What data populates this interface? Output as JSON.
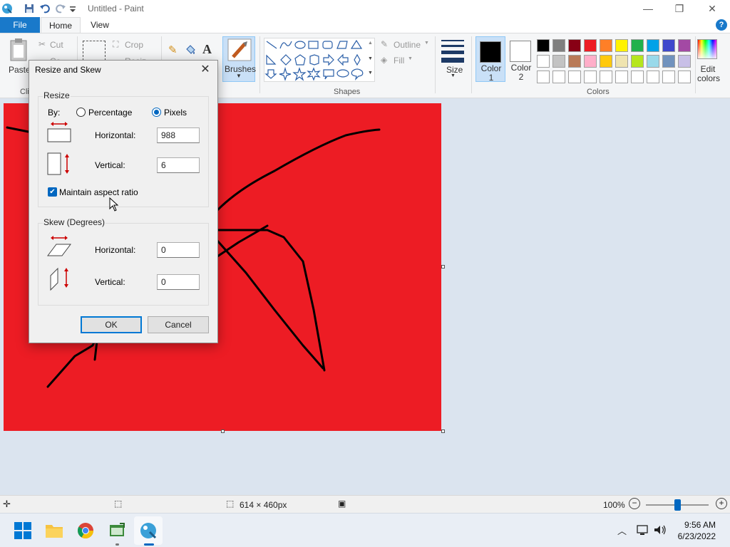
{
  "window": {
    "title": "Untitled - Paint",
    "minimize_glyph": "—",
    "restore_glyph": "❐",
    "close_glyph": "✕"
  },
  "menu": {
    "file": "File",
    "home": "Home",
    "view": "View",
    "help": "?"
  },
  "ribbon": {
    "paste": "Paste",
    "clipboard_label": "Cli",
    "cut": "Cut",
    "copy": "Co",
    "crop": "Crop",
    "resize": "Resiz",
    "brushes": "Brushes",
    "outline": "Outline",
    "fill": "Fill",
    "shapes_label": "Shapes",
    "size": "Size",
    "color1_label": "Color\n1",
    "color1_line1": "Color",
    "color1_line2": "1",
    "color2_line1": "Color",
    "color2_line2": "2",
    "edit_colors_line1": "Edit",
    "edit_colors_line2": "colors",
    "colors_label": "Colors",
    "color1_value": "#000000",
    "color2_value": "#ffffff",
    "palette_row1": [
      "#000000",
      "#7f7f7f",
      "#880015",
      "#ed1c24",
      "#ff7f27",
      "#fff200",
      "#22b14c",
      "#00a2e8",
      "#3f48cc",
      "#a349a4"
    ],
    "palette_row2": [
      "#ffffff",
      "#c3c3c3",
      "#b97a57",
      "#ffaec9",
      "#ffc90e",
      "#efe4b0",
      "#b5e61d",
      "#99d9ea",
      "#7092be",
      "#c8bfe7"
    ],
    "palette_row3": [
      "#ffffff",
      "#ffffff",
      "#ffffff",
      "#ffffff",
      "#ffffff",
      "#ffffff",
      "#ffffff",
      "#ffffff",
      "#ffffff",
      "#ffffff"
    ]
  },
  "canvas": {
    "background": "#ed1c24"
  },
  "dialog": {
    "title": "Resize and Skew",
    "resize_legend": "Resize",
    "by_label": "By:",
    "percentage_label": "Percentage",
    "pixels_label": "Pixels",
    "pixels_selected": true,
    "horizontal_label": "Horizontal:",
    "horizontal_value": "988",
    "vertical_label": "Vertical:",
    "vertical_value": "6",
    "maintain_aspect_label": "Maintain aspect ratio",
    "maintain_aspect_checked": true,
    "skew_legend": "Skew (Degrees)",
    "skew_horizontal_label": "Horizontal:",
    "skew_horizontal_value": "0",
    "skew_vertical_label": "Vertical:",
    "skew_vertical_value": "0",
    "ok": "OK",
    "cancel": "Cancel"
  },
  "statusbar": {
    "image_size": "614 × 460px",
    "zoom": "100%"
  },
  "taskbar": {
    "time": "9:56 AM",
    "date": "6/23/2022"
  }
}
